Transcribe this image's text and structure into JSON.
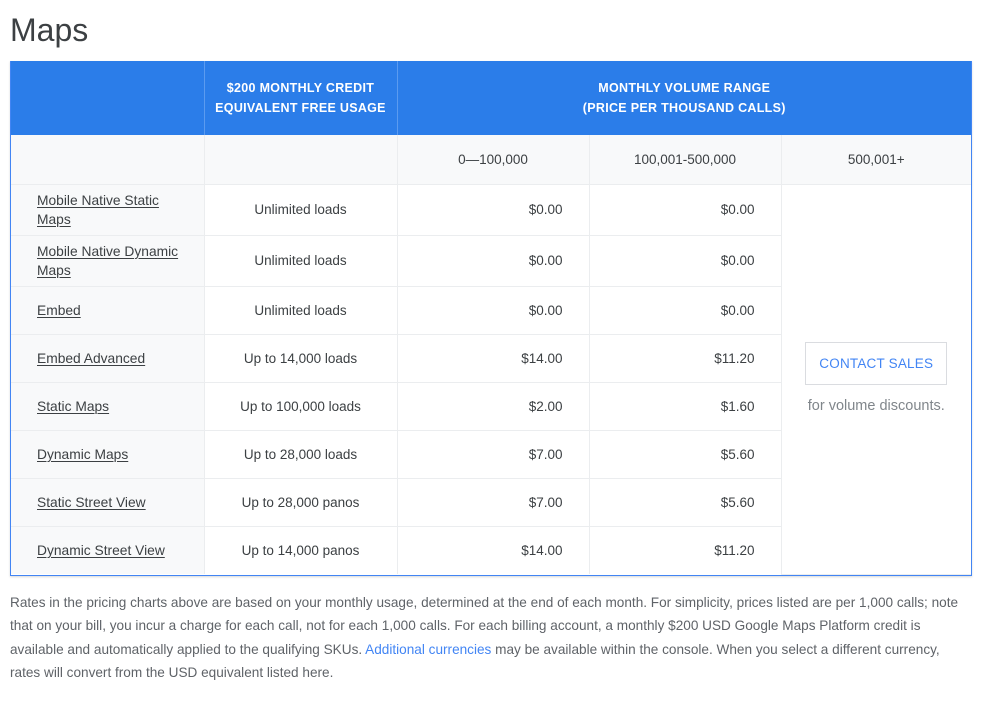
{
  "page": {
    "title": "Maps"
  },
  "table": {
    "header": {
      "blank_label": "",
      "credit_label": "$200 MONTHLY CREDIT EQUIVALENT FREE USAGE",
      "volume_label_line1": "MONTHLY VOLUME RANGE",
      "volume_label_line2": "(PRICE PER THOUSAND CALLS)"
    },
    "subheader": {
      "blank_a": "",
      "blank_b": "",
      "range_1": "0—100,000",
      "range_2": "100,001-500,000",
      "range_3": "500,001+"
    },
    "rows": [
      {
        "sku": "Mobile Native Static Maps",
        "free_usage": "Unlimited loads",
        "price_tier1": "$0.00",
        "price_tier2": "$0.00"
      },
      {
        "sku": "Mobile Native Dynamic Maps",
        "free_usage": "Unlimited loads",
        "price_tier1": "$0.00",
        "price_tier2": "$0.00"
      },
      {
        "sku": "Embed",
        "free_usage": "Unlimited loads",
        "price_tier1": "$0.00",
        "price_tier2": "$0.00"
      },
      {
        "sku": "Embed Advanced",
        "free_usage": "Up to 14,000 loads",
        "price_tier1": "$14.00",
        "price_tier2": "$11.20"
      },
      {
        "sku": "Static Maps",
        "free_usage": "Up to 100,000 loads",
        "price_tier1": "$2.00",
        "price_tier2": "$1.60"
      },
      {
        "sku": "Dynamic Maps",
        "free_usage": "Up to 28,000 loads",
        "price_tier1": "$7.00",
        "price_tier2": "$5.60"
      },
      {
        "sku": "Static Street View",
        "free_usage": "Up to 28,000 panos",
        "price_tier1": "$7.00",
        "price_tier2": "$5.60"
      },
      {
        "sku": "Dynamic Street View",
        "free_usage": "Up to 14,000 panos",
        "price_tier1": "$14.00",
        "price_tier2": "$11.20"
      }
    ],
    "contact": {
      "button_label": "CONTACT SALES",
      "note": "for volume discounts."
    }
  },
  "footnote": {
    "part1": "Rates in the pricing charts above are based on your monthly usage, determined at the end of each month. For simplicity, prices listed are per 1,000 calls; note that on your bill, you incur a charge for each call, not for each 1,000 calls. For each billing account, a monthly $200 USD Google Maps Platform credit is available and automatically applied to the qualifying SKUs. ",
    "link": "Additional currencies",
    "part2": " may be available within the console. When you select a different currency, rates will convert from the USD equivalent listed here."
  },
  "colors": {
    "header_blue": "#2b7de9",
    "link_blue": "#4285f4",
    "text_gray": "#3c4043",
    "muted_gray": "#80868b",
    "row_alt": "#f8f9fa",
    "border_light": "#ebedef"
  }
}
